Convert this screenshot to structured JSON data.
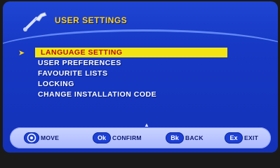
{
  "header": {
    "title": "USER SETTINGS",
    "icon": "wrench-icon"
  },
  "menu": {
    "pointer_icon": "arrow-pointer-icon",
    "items": [
      {
        "label": "LANGUAGE SETTING",
        "selected": true
      },
      {
        "label": "USER PREFERENCES",
        "selected": false
      },
      {
        "label": "FAVOURITE LISTS",
        "selected": false
      },
      {
        "label": "LOCKING",
        "selected": false
      },
      {
        "label": "CHANGE INSTALLATION CODE",
        "selected": false
      }
    ]
  },
  "footer": {
    "hints": [
      {
        "key": "",
        "label": "MOVE",
        "icon": "dpad-icon"
      },
      {
        "key": "Ok",
        "label": "CONFIRM"
      },
      {
        "key": "Bk",
        "label": "BACK"
      },
      {
        "key": "Ex",
        "label": "EXIT"
      }
    ]
  },
  "colors": {
    "background": "#1638c4",
    "title": "#ffd21a",
    "highlight": "#f2e414",
    "highlight_text": "#b21010",
    "footer_bar": "#b9c6ff",
    "badge": "#1c3fd6"
  }
}
